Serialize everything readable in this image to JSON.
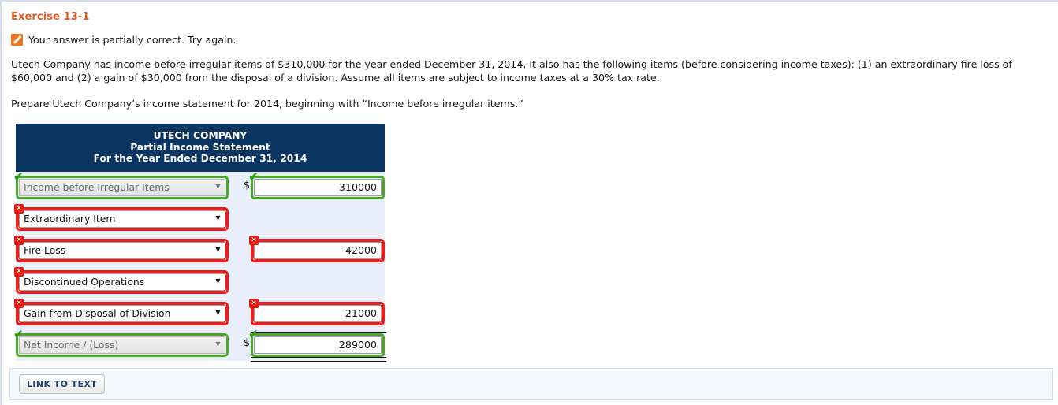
{
  "exercise": {
    "title": "Exercise 13-1"
  },
  "status": {
    "icon": "partial-correct-icon",
    "message": "Your answer is partially correct.  Try again."
  },
  "problem": {
    "paragraph": "Utech Company has income before irregular items of $310,000 for the year ended December 31, 2014. It also has the following items (before considering income taxes): (1) an extraordinary fire loss of $60,000 and (2) a gain of $30,000 from the disposal of a division. Assume all items are subject to income taxes at a 30% tax rate.",
    "instruction": "Prepare Utech Company’s income statement for 2014, beginning with “Income before irregular items.”"
  },
  "statement": {
    "header": {
      "company": "UTECH COMPANY",
      "title": "Partial Income Statement",
      "period": "For the Year Ended December 31, 2014"
    },
    "currency_symbol": "$",
    "dropdown_arrow": "▼",
    "rows": [
      {
        "label": "Income before Irregular Items",
        "label_status": "correct",
        "label_badge": "✔",
        "amount": "310000",
        "amount_status": "correct",
        "amount_badge": "✔",
        "show_dollar": true,
        "has_amount": true,
        "top_rule": false,
        "double_rule": false
      },
      {
        "label": "Extraordinary Item",
        "label_status": "incorrect",
        "label_badge": "✕",
        "amount": "",
        "amount_status": "none",
        "amount_badge": "",
        "show_dollar": false,
        "has_amount": false,
        "top_rule": false,
        "double_rule": false
      },
      {
        "label": "Fire Loss",
        "label_status": "incorrect",
        "label_badge": "✕",
        "amount": "-42000",
        "amount_status": "incorrect",
        "amount_badge": "✕",
        "show_dollar": false,
        "has_amount": true,
        "top_rule": false,
        "double_rule": false
      },
      {
        "label": "Discontinued Operations",
        "label_status": "incorrect",
        "label_badge": "✕",
        "amount": "",
        "amount_status": "none",
        "amount_badge": "",
        "show_dollar": false,
        "has_amount": false,
        "top_rule": false,
        "double_rule": false
      },
      {
        "label": "Gain from Disposal of Division",
        "label_status": "incorrect",
        "label_badge": "✕",
        "amount": "21000",
        "amount_status": "incorrect",
        "amount_badge": "✕",
        "show_dollar": false,
        "has_amount": true,
        "top_rule": false,
        "double_rule": false
      },
      {
        "label": "Net Income / (Loss)",
        "label_status": "correct",
        "label_badge": "✔",
        "amount": "289000",
        "amount_status": "correct",
        "amount_badge": "✔",
        "show_dollar": true,
        "has_amount": true,
        "top_rule": true,
        "double_rule": true
      }
    ]
  },
  "footer": {
    "link_to_text_label": "LINK TO TEXT"
  },
  "colors": {
    "accent_orange": "#e2581e",
    "header_navy": "#0a3560",
    "correct_green": "#4aa824",
    "incorrect_red": "#ee1c19",
    "table_bg": "#e8effa"
  }
}
